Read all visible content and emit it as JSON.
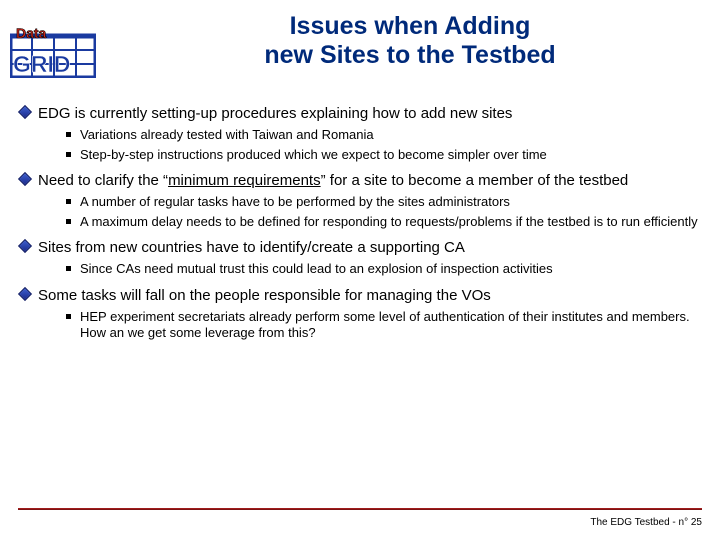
{
  "title": {
    "line1": "Issues when Adding",
    "line2": "new Sites to the Testbed"
  },
  "bullets": [
    {
      "text": "EDG is currently setting-up procedures explaining how to add new sites",
      "sub": [
        "Variations already tested with Taiwan and Romania",
        "Step-by-step instructions produced which we expect to become simpler over time"
      ]
    },
    {
      "pre": "Need to clarify the “",
      "underlined": "minimum requirements",
      "post": "” for a site to become a member of the testbed",
      "sub": [
        "A number of regular tasks have to be performed by the sites administrators",
        "A maximum delay needs to be defined for responding to requests/problems if the testbed is to run efficiently"
      ]
    },
    {
      "text": "Sites from new countries have to identify/create a supporting CA",
      "sub": [
        "Since CAs need mutual trust this could lead to an explosion of inspection activities"
      ]
    },
    {
      "text": "Some tasks will fall on the people responsible for managing the VOs",
      "sub": [
        "HEP experiment secretariats already perform some level of authentication of their institutes and members. How an we get some leverage from this?"
      ]
    }
  ],
  "footer": "The EDG Testbed - n° 25"
}
